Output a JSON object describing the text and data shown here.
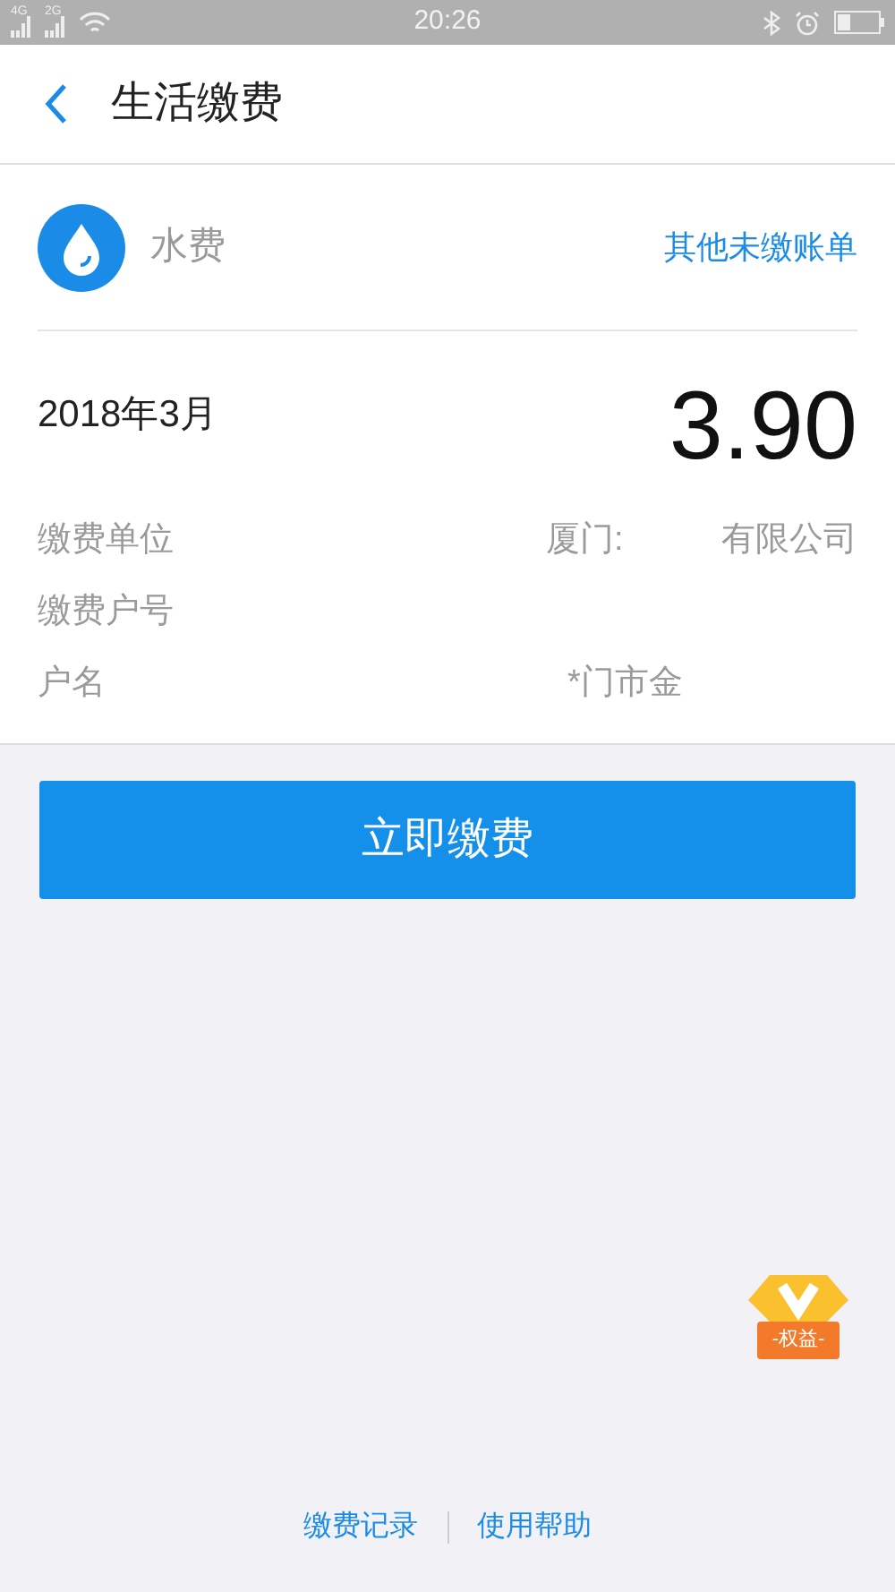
{
  "status_bar": {
    "network_1": "4G",
    "network_2": "2G",
    "time": "20:26"
  },
  "header": {
    "title": "生活缴费"
  },
  "bill": {
    "type": "水费",
    "other_bills_link": "其他未缴账单",
    "period": "2018年3月",
    "amount": "3.90",
    "fields": [
      {
        "label": "缴费单位",
        "value_parts": [
          "厦门:",
          "有限公司"
        ]
      },
      {
        "label": "缴费户号"
      },
      {
        "label": "户名",
        "value_parts": [
          "*门市金"
        ]
      }
    ]
  },
  "pay_button": "立即缴费",
  "badge": {
    "label": "-权益-"
  },
  "footer_links": [
    "缴费记录",
    "使用帮助"
  ]
}
